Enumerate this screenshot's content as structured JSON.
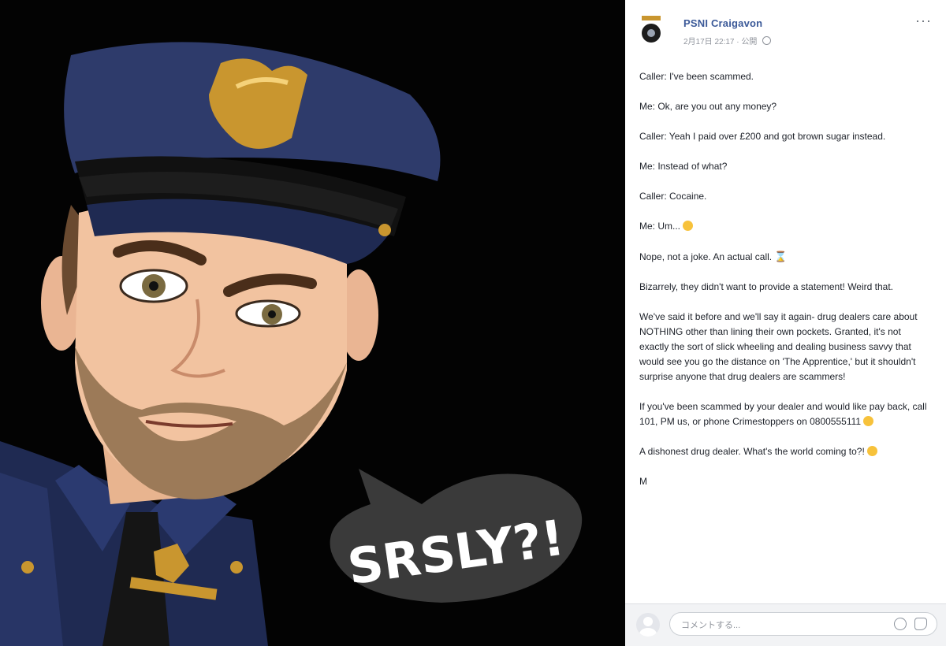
{
  "post": {
    "page_name": "PSNI Craigavon",
    "meta": "2月17日 22:17 · 公開",
    "paragraphs": [
      "Caller: I've been scammed.",
      "Me: Ok, are you out any money?",
      "Caller: Yeah I paid over £200 and got brown sugar instead.",
      "Me: Instead of what?",
      "Caller: Cocaine.",
      "Me: Um...",
      "Nope, not a joke. An actual call.",
      "Bizarrely, they didn't want to provide a statement! Weird that.",
      "We've said it before and we'll say it again- drug dealers care about NOTHING other than lining their own pockets. Granted, it's not exactly the sort of slick wheeling and dealing business savvy that would see you go the distance on 'The Apprentice,' but it shouldn't surprise anyone that drug dealers are scammers!",
      "If you've been scammed by your dealer and would like pay back, call 101, PM us, or phone Crimestoppers on 0800555111",
      "A dishonest drug dealer. What's the world coming to?!",
      "M"
    ]
  },
  "comment": {
    "placeholder": "コメントする..."
  },
  "image": {
    "speech_bubble_text": "SRSLY?!"
  },
  "colors": {
    "brand_link": "#3b5998",
    "uniform": "#1f2a52",
    "badge": "#c9962f",
    "background": "#030303"
  },
  "icons": [
    "police-crest-icon",
    "more-options-icon",
    "globe-icon",
    "emoji-icon",
    "sticker-icon",
    "user-avatar-icon"
  ]
}
